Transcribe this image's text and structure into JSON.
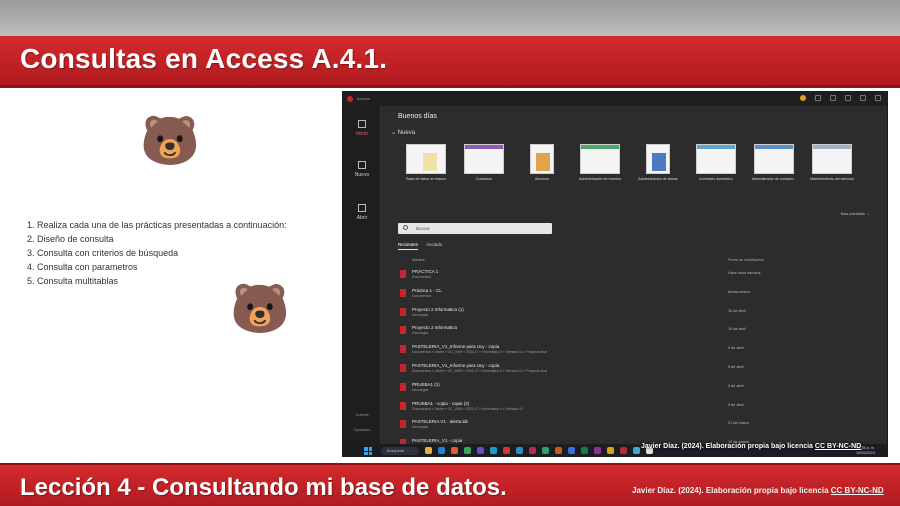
{
  "slide": {
    "title": "Consultas en Access A.4.1.",
    "lesson_title": "Lección 4 - Consultando mi base de datos.",
    "credit_prefix": "Javier Díaz. (2024). Elaboración propia bajo licencia",
    "credit_license": "CC BY-NC-ND"
  },
  "tasks": [
    "1. Realiza cada una de las prácticas presentadas a continuación:",
    "2. Diseño de consulta",
    "3. Consulta con criterios de búsqueda",
    "4. Consulta con parametros",
    "5. Consulta multitablas"
  ],
  "access": {
    "app_name": "Access",
    "greeting": "Buenos días",
    "new_section": "Nueva",
    "sidebar": [
      {
        "label": "Inicio",
        "icon": "home-icon"
      },
      {
        "label": "Nuevo",
        "icon": "new-file-icon"
      },
      {
        "label": "Abrir",
        "icon": "folder-icon"
      }
    ],
    "sidebar_bottom": [
      "Cuenta",
      "Opciones"
    ],
    "templates": [
      "Base de datos en blanco",
      "Contactos",
      "Alumnos",
      "Administración de eventos",
      "Administración de tareas",
      "Inventario doméstico",
      "Administrador de contacto...",
      "Mantenimiento del vehículo"
    ],
    "more_templates": "Más plantillas",
    "search_placeholder": "Buscar",
    "tabs": [
      "Recientes",
      "Anclado"
    ],
    "columns": {
      "name": "Nombre",
      "date": "Fecha de modificación"
    },
    "recent_files": [
      {
        "name": "PRÁCTICA 1",
        "path": "Documentos",
        "date": "Hace unos minutos"
      },
      {
        "name": "Práctica 1 - CL",
        "path": "Documentos",
        "date": "Ahora mismo"
      },
      {
        "name": "Proyecto 2 Informatica (1)",
        "path": "Descargas",
        "date": "15 de abril"
      },
      {
        "name": "Proyecto 2 Informatica",
        "path": "Descargas",
        "date": "15 de abril"
      },
      {
        "name": "PASTELERIA_V1_Informe para Ucy - copia",
        "path": "Documentos » Javier » GC_UVM » 2023-17 » Informática II » Semana 11 » Proyecto final",
        "date": "9 de abril"
      },
      {
        "name": "PASTELERIA_V1_Informe para Ucy - copia",
        "path": "Documentos » Javier » GC_UVM » 2023-17 » Informática II » Semana 11 » Proyecto final",
        "date": "9 de abril"
      },
      {
        "name": "PRUEBA1 (1)",
        "path": "Descargas",
        "date": "3 de abril"
      },
      {
        "name": "PRUEBA1 - copia - copia (2)",
        "path": "Documentos » Javier » GC_UVM » 2023-17 » Informática II » Semana 10",
        "date": "3 de abril"
      },
      {
        "name": "PASTELERIA V1 - alerta.ldc",
        "path": "Descargas",
        "date": "21 de marzo"
      },
      {
        "name": "PASTELERIA_V1 - copia",
        "path": "Documentos » Javier » GC_UVM » 2023-17 » Informática II » Proyecto",
        "date": "12 de marzo"
      }
    ],
    "taskbar": {
      "search": "Búsqueda",
      "time": "10:35 a. m.",
      "date": "10/05/2024"
    }
  }
}
